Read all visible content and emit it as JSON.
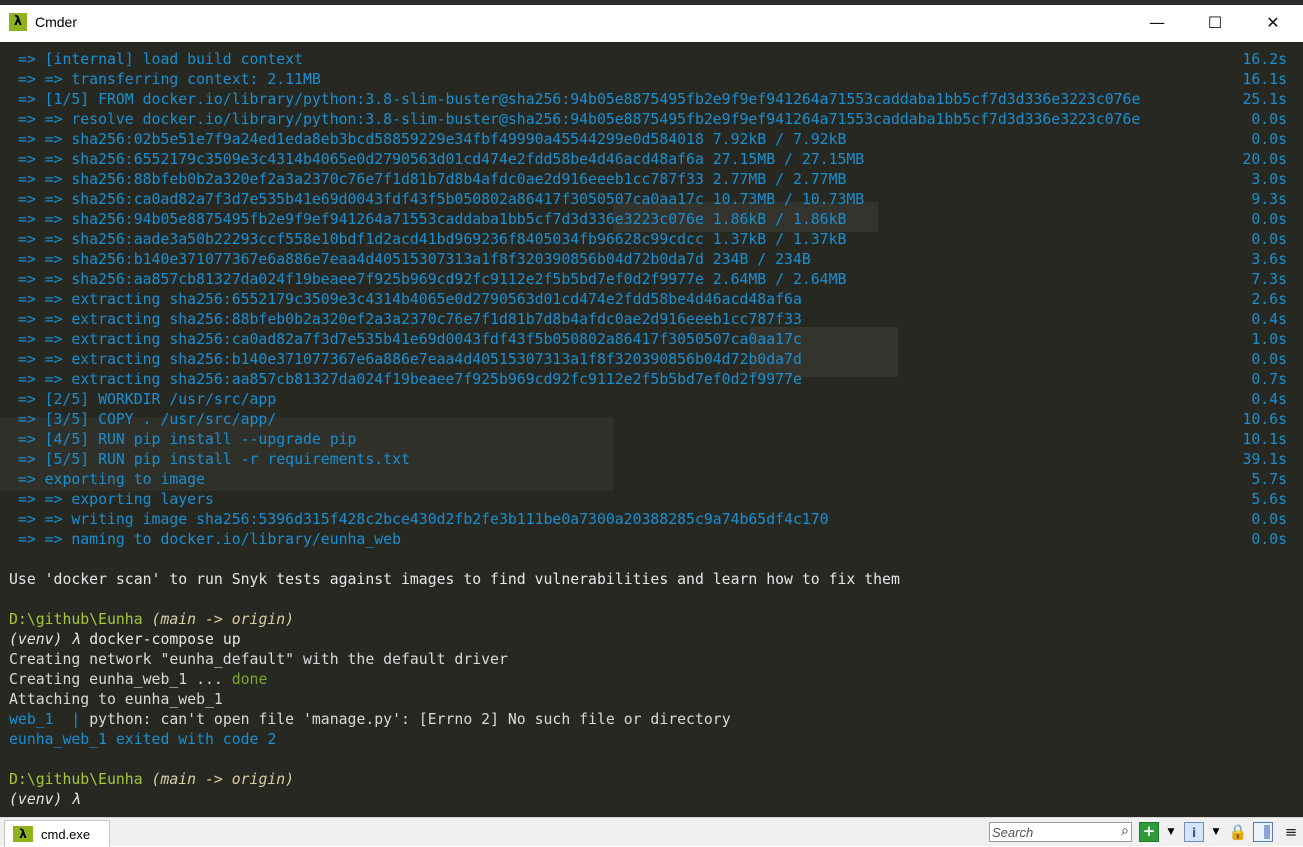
{
  "window": {
    "title": "Cmder",
    "icon": "lambda-icon",
    "minimize": "—",
    "maximize": "☐",
    "close": "✕"
  },
  "build_lines": [
    {
      "text": " => [internal] load build context",
      "duration": "16.2s"
    },
    {
      "text": " => => transferring context: 2.11MB",
      "duration": "16.1s"
    },
    {
      "text": " => [1/5] FROM docker.io/library/python:3.8-slim-buster@sha256:94b05e8875495fb2e9f9ef941264a71553caddaba1bb5cf7d3d336e3223c076e",
      "duration": "25.1s"
    },
    {
      "text": " => => resolve docker.io/library/python:3.8-slim-buster@sha256:94b05e8875495fb2e9f9ef941264a71553caddaba1bb5cf7d3d336e3223c076e",
      "duration": "0.0s"
    },
    {
      "text": " => => sha256:02b5e51e7f9a24ed1eda8eb3bcd58859229e34fbf49990a45544299e0d584018 7.92kB / 7.92kB",
      "duration": "0.0s"
    },
    {
      "text": " => => sha256:6552179c3509e3c4314b4065e0d2790563d01cd474e2fdd58be4d46acd48af6a 27.15MB / 27.15MB",
      "duration": "20.0s"
    },
    {
      "text": " => => sha256:88bfeb0b2a320ef2a3a2370c76e7f1d81b7d8b4afdc0ae2d916eeeb1cc787f33 2.77MB / 2.77MB",
      "duration": "3.0s"
    },
    {
      "text": " => => sha256:ca0ad82a7f3d7e535b41e69d0043fdf43f5b050802a86417f3050507ca0aa17c 10.73MB / 10.73MB",
      "duration": "9.3s"
    },
    {
      "text": " => => sha256:94b05e8875495fb2e9f9ef941264a71553caddaba1bb5cf7d3d336e3223c076e 1.86kB / 1.86kB",
      "duration": "0.0s"
    },
    {
      "text": " => => sha256:aade3a50b22293ccf558e10bdf1d2acd41bd969236f8405034fb96628c99cdcc 1.37kB / 1.37kB",
      "duration": "0.0s"
    },
    {
      "text": " => => sha256:b140e371077367e6a886e7eaa4d40515307313a1f8f320390856b04d72b0da7d 234B / 234B",
      "duration": "3.6s"
    },
    {
      "text": " => => sha256:aa857cb81327da024f19beaee7f925b969cd92fc9112e2f5b5bd7ef0d2f9977e 2.64MB / 2.64MB",
      "duration": "7.3s"
    },
    {
      "text": " => => extracting sha256:6552179c3509e3c4314b4065e0d2790563d01cd474e2fdd58be4d46acd48af6a",
      "duration": "2.6s"
    },
    {
      "text": " => => extracting sha256:88bfeb0b2a320ef2a3a2370c76e7f1d81b7d8b4afdc0ae2d916eeeb1cc787f33",
      "duration": "0.4s"
    },
    {
      "text": " => => extracting sha256:ca0ad82a7f3d7e535b41e69d0043fdf43f5b050802a86417f3050507ca0aa17c",
      "duration": "1.0s"
    },
    {
      "text": " => => extracting sha256:b140e371077367e6a886e7eaa4d40515307313a1f8f320390856b04d72b0da7d",
      "duration": "0.0s"
    },
    {
      "text": " => => extracting sha256:aa857cb81327da024f19beaee7f925b969cd92fc9112e2f5b5bd7ef0d2f9977e",
      "duration": "0.7s"
    },
    {
      "text": " => [2/5] WORKDIR /usr/src/app",
      "duration": "0.4s"
    },
    {
      "text": " => [3/5] COPY . /usr/src/app/",
      "duration": "10.6s"
    },
    {
      "text": " => [4/5] RUN pip install --upgrade pip",
      "duration": "10.1s"
    },
    {
      "text": " => [5/5] RUN pip install -r requirements.txt",
      "duration": "39.1s"
    },
    {
      "text": " => exporting to image",
      "duration": "5.7s"
    },
    {
      "text": " => => exporting layers",
      "duration": "5.6s"
    },
    {
      "text": " => => writing image sha256:5396d315f428c2bce430d2fb2fe3b111be0a7300a20388285c9a74b65df4c170",
      "duration": "0.0s"
    },
    {
      "text": " => => naming to docker.io/library/eunha_web",
      "duration": "0.0s"
    }
  ],
  "snyk_hint": "Use 'docker scan' to run Snyk tests against images to find vulnerabilities and learn how to fix them",
  "prompt1": {
    "path": "D:\\github\\Eunha",
    "branch": " (main -> origin)"
  },
  "cmd1": {
    "venv": "(venv) λ",
    "command": " docker-compose up"
  },
  "out_network": "Creating network \"eunha_default\" with the default driver",
  "out_creating": "Creating eunha_web_1 ... ",
  "out_done": "done",
  "out_attaching": "Attaching to eunha_web_1",
  "out_web_prefix": "web_1  | ",
  "out_web_error": "python: can't open file 'manage.py': [Errno 2] No such file or directory",
  "out_exited": "eunha_web_1 exited with code 2",
  "prompt2": {
    "path": "D:\\github\\Eunha",
    "branch": " (main -> origin)"
  },
  "cmd2": {
    "venv": "(venv) λ"
  },
  "statusbar": {
    "tab_icon": "λ",
    "tab_label": "cmd.exe",
    "search_placeholder": "Search",
    "new_console": "+",
    "tile": "i",
    "dropdown_arrow": "▼",
    "lock": "🔒",
    "menu": "≡"
  },
  "colors": {
    "terminal_bg": "#272822",
    "build_text": "#1a8fd0",
    "prompt_path": "#a6c63a",
    "done": "#7fa62a",
    "accent": "#8fb31d"
  }
}
